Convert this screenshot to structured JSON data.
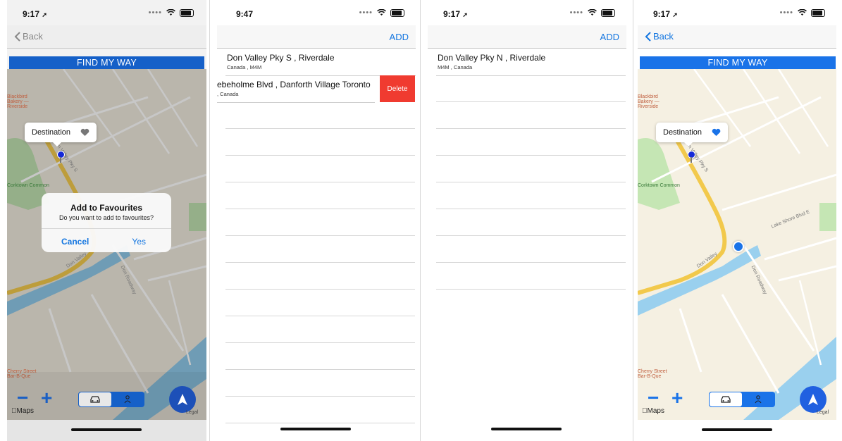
{
  "screens": [
    {
      "status": {
        "time": "9:17",
        "time_arrow": "➚"
      },
      "nav": {
        "back_label": "Back"
      },
      "banner": "FIND MY WAY",
      "callout": {
        "label": "Destination"
      },
      "alert": {
        "title": "Add to Favourites",
        "message": "Do you want to add to favourites?",
        "cancel": "Cancel",
        "confirm": "Yes"
      },
      "maps_logo": "Maps",
      "legal": "Legal",
      "map_labels": [
        "Blackbird Bakery — Riverside",
        "Don Valley Pky S",
        "Don Valley",
        "Don Roadway",
        "Cherry Street Bar-B-Que",
        "Corktown Common"
      ]
    },
    {
      "status": {
        "time": "9:47"
      },
      "nav": {
        "add_label": "ADD"
      },
      "rows": [
        {
          "title": "Don Valley Pky S , Riverdale",
          "subtitle": "Canada , M4M"
        },
        {
          "title": "ebeholme Blvd , Danforth Village Toronto",
          "subtitle": ", Canada"
        }
      ],
      "delete_label": "Delete"
    },
    {
      "status": {
        "time": "9:17",
        "time_arrow": "➚"
      },
      "nav": {
        "add_label": "ADD"
      },
      "rows": [
        {
          "title": "Don Valley Pky N , Riverdale",
          "subtitle": "M4M , Canada"
        }
      ]
    },
    {
      "status": {
        "time": "9:17",
        "time_arrow": "➚"
      },
      "nav": {
        "back_label": "Back"
      },
      "banner": "FIND MY WAY",
      "callout": {
        "label": "Destination"
      },
      "maps_logo": "Maps",
      "legal": "Legal",
      "map_labels": [
        "Blackbird Bakery — Riverside",
        "Don Valley Pky S",
        "Don Valley",
        "Don Roadway",
        "Lake Shore Blvd E",
        "Cherry Street Bar-B-Que",
        "Corktown Common"
      ]
    }
  ],
  "colors": {
    "accent": "#1a73e8",
    "delete": "#f03b30",
    "heart_active": "#1a73e8",
    "heart_inactive": "#777777"
  }
}
